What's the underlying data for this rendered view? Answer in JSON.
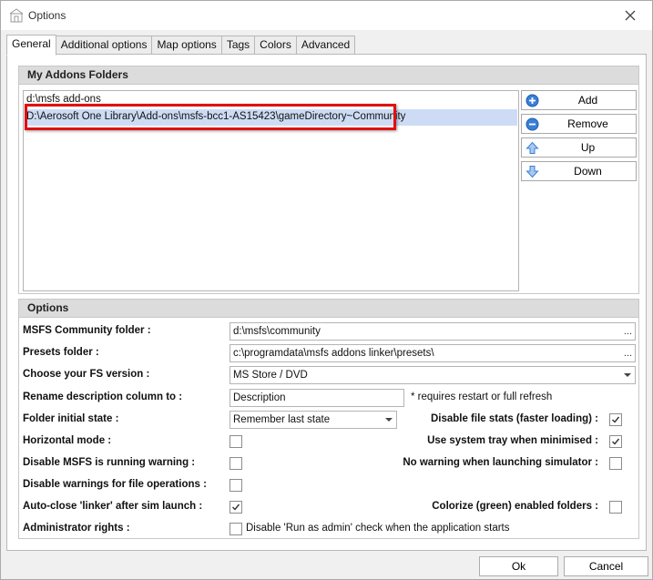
{
  "window": {
    "title": "Options",
    "icon": "options-app-icon",
    "close_icon": "close-icon"
  },
  "tabs": [
    {
      "label": "General",
      "active": true
    },
    {
      "label": "Additional options",
      "active": false
    },
    {
      "label": "Map options",
      "active": false
    },
    {
      "label": "Tags",
      "active": false
    },
    {
      "label": "Colors",
      "active": false
    },
    {
      "label": "Advanced",
      "active": false
    }
  ],
  "addons": {
    "header": "My Addons Folders",
    "folders": [
      {
        "path": "d:\\msfs add-ons",
        "selected": false
      },
      {
        "path": "D:\\Aerosoft One Library\\Add-ons\\msfs-bcc1-AS15423\\gameDirectory~Community",
        "selected": true
      }
    ],
    "buttons": [
      {
        "label": "Add",
        "icon": "add-circle-icon"
      },
      {
        "label": "Remove",
        "icon": "remove-circle-icon"
      },
      {
        "label": "Up",
        "icon": "arrow-up-icon"
      },
      {
        "label": "Down",
        "icon": "arrow-down-icon"
      }
    ],
    "highlight_color": "#e01010"
  },
  "options": {
    "header": "Options",
    "community_folder": {
      "label": "MSFS Community folder :",
      "value": "d:\\msfs\\community",
      "browse": "..."
    },
    "presets_folder": {
      "label": "Presets folder :",
      "value": "c:\\programdata\\msfs addons linker\\presets\\",
      "browse": "..."
    },
    "fs_version": {
      "label": "Choose your FS version :",
      "value": "MS Store / DVD"
    },
    "rename_column": {
      "label": "Rename description column to :",
      "value": "Description",
      "note": "* requires restart or full refresh"
    },
    "folder_state": {
      "label": "Folder initial state :",
      "value": "Remember last state"
    },
    "disable_file_stats": {
      "label": "Disable file stats (faster loading) :",
      "checked": true
    },
    "horizontal_mode": {
      "label": "Horizontal mode :",
      "checked": false
    },
    "system_tray": {
      "label": "Use system tray when minimised :",
      "checked": true
    },
    "disable_running_warning": {
      "label": "Disable MSFS is running warning :",
      "checked": false
    },
    "no_warning_launch": {
      "label": "No warning when launching simulator :",
      "checked": false
    },
    "disable_file_warnings": {
      "label": "Disable warnings for file operations :",
      "checked": false
    },
    "auto_close": {
      "label": "Auto-close 'linker' after sim launch :",
      "checked": true
    },
    "colorize": {
      "label": "Colorize (green) enabled folders :",
      "checked": false
    },
    "admin_rights": {
      "label": "Administrator rights :",
      "checkbox_text": "Disable 'Run as admin' check when the application starts",
      "checked": false
    }
  },
  "footer": {
    "ok": "Ok",
    "cancel": "Cancel"
  }
}
